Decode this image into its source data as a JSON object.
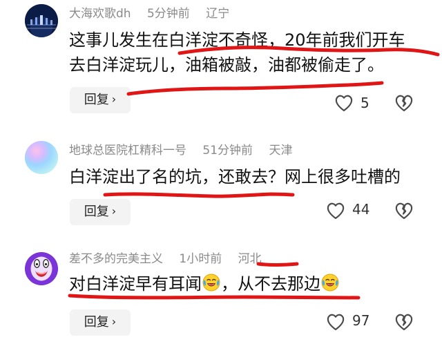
{
  "comments": [
    {
      "username": "大海欢歌dh",
      "time": "5分钟前",
      "location": "辽宁",
      "text_lines": [
        "这事儿发生在白洋淀不奇怪，20年前我们开车",
        "去白洋淀玩儿，油箱被敲，油都被偷走了。"
      ],
      "reply_label": "回复",
      "like_count": "5",
      "avatar_icon": "night-city-avatar"
    },
    {
      "username": "地球总医院杠精科一号",
      "time": "51分钟前",
      "location": "天津",
      "text_lines": [
        "白洋淀出了名的坑，还敢去？网上很多吐槽的"
      ],
      "reply_label": "回复",
      "like_count": "44",
      "avatar_icon": "gradient-avatar"
    },
    {
      "username": "差不多的完美主义",
      "time": "1小时前",
      "location": "河北",
      "text_part1": "对白洋淀早有耳闻",
      "text_part2": "，从不去那边",
      "reply_label": "回复",
      "like_count": "97",
      "avatar_icon": "screaming-purple-avatar"
    }
  ],
  "icons": {
    "like": "heart-outline-icon",
    "dislike": "broken-heart-icon",
    "reply_chevron": "chevron-right-icon",
    "laugh_cry": "laughing-crying-emoji"
  },
  "colors": {
    "underline_red": "#e01616",
    "meta_gray": "#8a8a8a",
    "reply_bg": "#f3f3f3"
  }
}
